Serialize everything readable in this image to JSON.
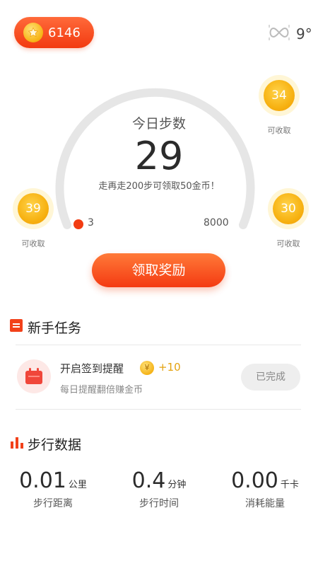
{
  "header": {
    "coins": "6146",
    "weather_icon": "infinity-icon",
    "temperature": "9°"
  },
  "steps": {
    "title": "今日步数",
    "value": "29",
    "hint": "走再走200步可领取50金币！",
    "min_label": "3",
    "max_label": "8000",
    "progress_fraction": 0.0036
  },
  "bubbles": [
    {
      "value": "34",
      "caption": "可收取"
    },
    {
      "value": "39",
      "caption": "可收取"
    },
    {
      "value": "30",
      "caption": "可收取"
    }
  ],
  "claim_button": "领取奖励",
  "tasks_section": {
    "title": "新手任务",
    "tasks": [
      {
        "title": "开启签到提醒",
        "coin_symbol": "¥",
        "reward": "+10",
        "subtitle": "每日提醒翻倍赚金币",
        "status": "已完成"
      }
    ]
  },
  "walk_section": {
    "title": "步行数据",
    "stats": [
      {
        "value": "0.01",
        "unit": "公里",
        "label": "步行距离"
      },
      {
        "value": "0.4",
        "unit": "分钟",
        "label": "步行时间"
      },
      {
        "value": "0.00",
        "unit": "千卡",
        "label": "消耗能量"
      }
    ]
  },
  "colors": {
    "accent": "#f4431a",
    "coin": "#f7b619",
    "track": "#e5e5e5"
  }
}
